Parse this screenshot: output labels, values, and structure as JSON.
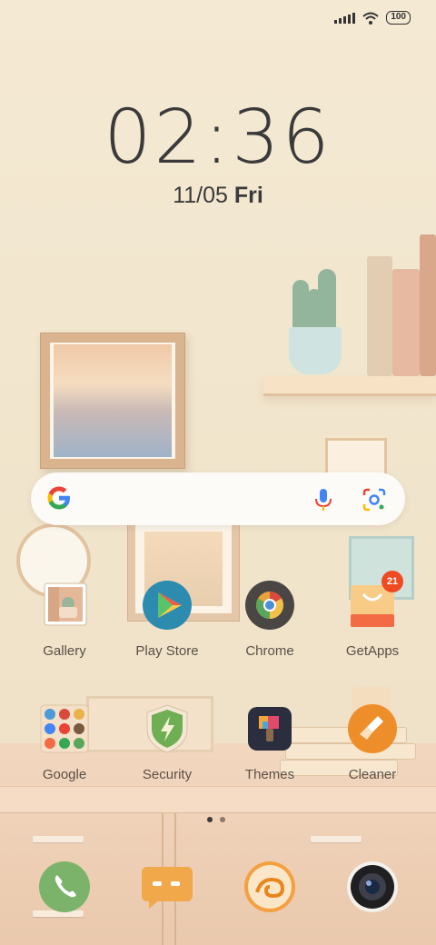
{
  "status_bar": {
    "battery": "100"
  },
  "clock": {
    "time": "02:36",
    "date": "11/05",
    "weekday": "Fri"
  },
  "search": {
    "logo": "G"
  },
  "apps_row1": [
    {
      "label": "Gallery",
      "icon": "gallery-icon"
    },
    {
      "label": "Play Store",
      "icon": "play-store-icon"
    },
    {
      "label": "Chrome",
      "icon": "chrome-icon"
    },
    {
      "label": "GetApps",
      "icon": "getapps-icon",
      "badge": "21"
    }
  ],
  "apps_row2": [
    {
      "label": "Google",
      "icon": "google-folder-icon"
    },
    {
      "label": "Security",
      "icon": "security-icon"
    },
    {
      "label": "Themes",
      "icon": "themes-icon"
    },
    {
      "label": "Cleaner",
      "icon": "cleaner-icon"
    }
  ],
  "dock": [
    {
      "icon": "phone-icon"
    },
    {
      "icon": "messages-icon"
    },
    {
      "icon": "uc-browser-icon"
    },
    {
      "icon": "camera-icon"
    }
  ],
  "page_indicator": {
    "pages": 2,
    "current": 1
  },
  "colors": {
    "wall": "#f2e6cf",
    "text": "#3a3a3a",
    "badge": "#ef4a22"
  }
}
